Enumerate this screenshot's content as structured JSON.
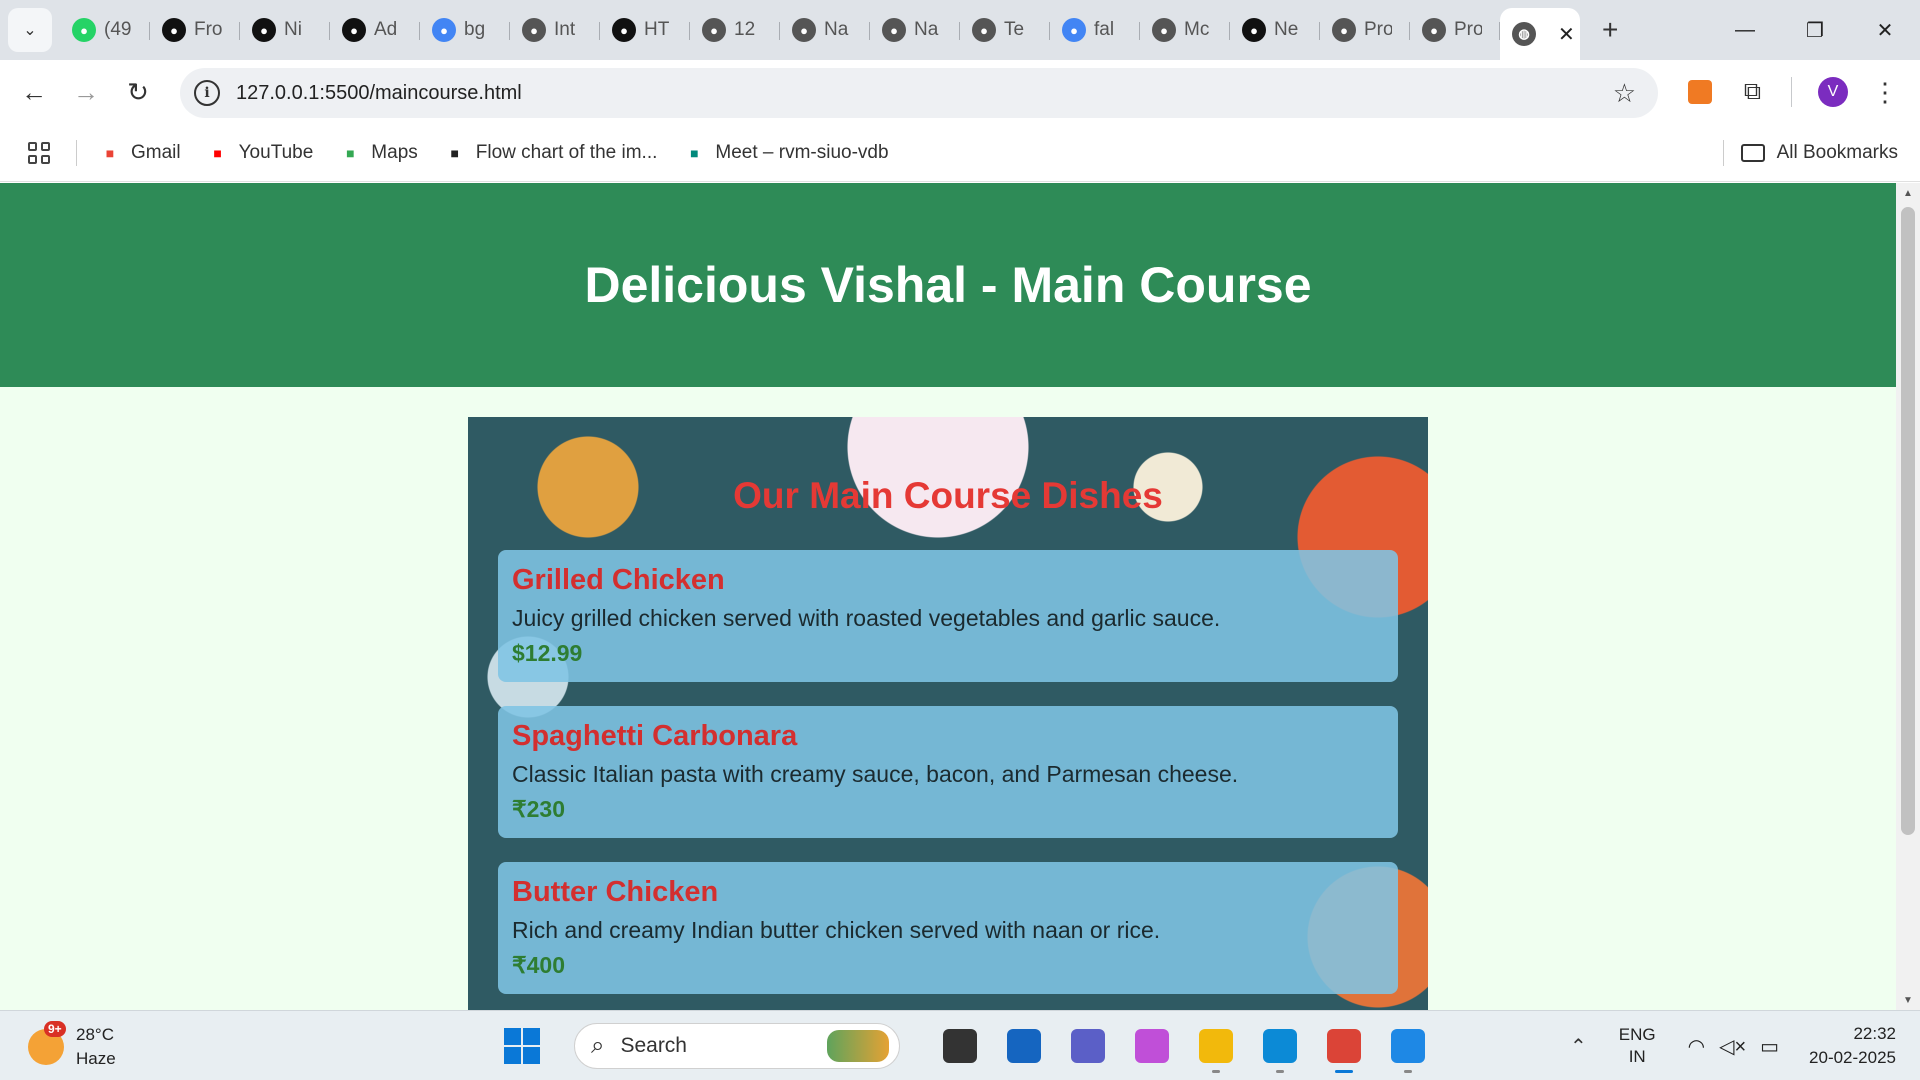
{
  "browser": {
    "tabs": [
      {
        "label": "(49",
        "icon": "whatsapp-icon",
        "color": "#25d366"
      },
      {
        "label": "Fro",
        "icon": "notion-icon",
        "color": "#111111"
      },
      {
        "label": "Ni",
        "icon": "github-icon",
        "color": "#111111"
      },
      {
        "label": "Ad",
        "icon": "github-icon",
        "color": "#111111"
      },
      {
        "label": "bg",
        "icon": "google-icon",
        "color": "#4285f4"
      },
      {
        "label": "Int",
        "icon": "globe-icon",
        "color": "#555555"
      },
      {
        "label": "HT",
        "icon": "openai-icon",
        "color": "#111111"
      },
      {
        "label": "12",
        "icon": "globe-icon",
        "color": "#555555"
      },
      {
        "label": "Na",
        "icon": "globe-icon",
        "color": "#555555"
      },
      {
        "label": "Na",
        "icon": "globe-icon",
        "color": "#555555"
      },
      {
        "label": "Te",
        "icon": "globe-icon",
        "color": "#555555"
      },
      {
        "label": "fal",
        "icon": "google-icon",
        "color": "#4285f4"
      },
      {
        "label": "Mc",
        "icon": "globe-icon",
        "color": "#555555"
      },
      {
        "label": "Ne",
        "icon": "github-icon",
        "color": "#111111"
      },
      {
        "label": "Pro",
        "icon": "globe-icon",
        "color": "#555555"
      },
      {
        "label": "Pro",
        "icon": "globe-icon",
        "color": "#555555"
      }
    ],
    "active_tab_icon": "globe-icon",
    "url": "127.0.0.1:5500/maincourse.html",
    "profile_initial": "V",
    "bookmarks": [
      {
        "label": "Gmail",
        "icon": "gmail-icon",
        "color": "#ea4335"
      },
      {
        "label": "YouTube",
        "icon": "youtube-icon",
        "color": "#ff0000"
      },
      {
        "label": "Maps",
        "icon": "maps-icon",
        "color": "#34a853"
      },
      {
        "label": "Flow chart of the im...",
        "icon": "r6-icon",
        "color": "#222222"
      },
      {
        "label": "Meet – rvm-siuo-vdb",
        "icon": "meet-icon",
        "color": "#00897b"
      }
    ],
    "all_bookmarks": "All Bookmarks"
  },
  "page": {
    "header_title": "Delicious Vishal - Main Course",
    "section_title": "Our Main Course Dishes",
    "dishes": [
      {
        "name": "Grilled Chicken",
        "description": "Juicy grilled chicken served with roasted vegetables and garlic sauce.",
        "price": "$12.99"
      },
      {
        "name": "Spaghetti Carbonara",
        "description": "Classic Italian pasta with creamy sauce, bacon, and Parmesan cheese.",
        "price": "₹230"
      },
      {
        "name": "Butter Chicken",
        "description": "Rich and creamy Indian butter chicken served with naan or rice.",
        "price": "₹400"
      }
    ],
    "colors": {
      "header_bg": "#2e8b57",
      "title_red": "#e53935",
      "price_green": "#2e7d32"
    }
  },
  "taskbar": {
    "weather_temp": "28°C",
    "weather_desc": "Haze",
    "weather_badge": "9+",
    "search_placeholder": "Search",
    "lang_line1": "ENG",
    "lang_line2": "IN",
    "time": "22:32",
    "date": "20-02-2025",
    "apps": [
      {
        "name": "file-explorer-dark-icon",
        "color": "#333333"
      },
      {
        "name": "microsoft-store-icon",
        "color": "#1565c0"
      },
      {
        "name": "teams-icon",
        "color": "#5b5fc7"
      },
      {
        "name": "copilot-icon",
        "color": "#c04fd8"
      },
      {
        "name": "file-explorer-icon",
        "color": "#f2b90c"
      },
      {
        "name": "edge-icon",
        "color": "#0c8ad6"
      },
      {
        "name": "chrome-icon",
        "color": "#db4437"
      },
      {
        "name": "vscode-icon",
        "color": "#1e88e5"
      }
    ]
  }
}
